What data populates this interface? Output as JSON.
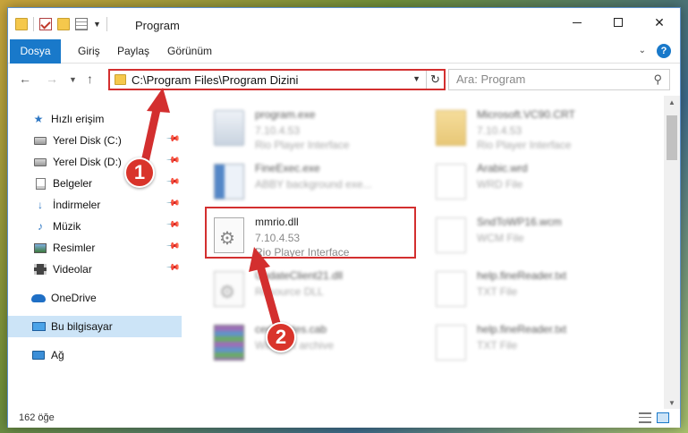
{
  "window": {
    "title": "Program",
    "minimize_glyph": "—",
    "maximize_glyph": "☐",
    "close_glyph": "✕"
  },
  "ribbon": {
    "file_tab": "Dosya",
    "tabs": [
      "Giriş",
      "Paylaş",
      "Görünüm"
    ],
    "help_glyph": "?",
    "expand_glyph": "⌄"
  },
  "address_bar": {
    "path": "C:\\Program Files\\Program Dizini",
    "refresh_glyph": "↻"
  },
  "search": {
    "placeholder": "Ara: Program"
  },
  "nav_pane": {
    "quick_access": "Hızlı erişim",
    "items": [
      {
        "label": "Yerel Disk (C:)",
        "icon": "disk-icon"
      },
      {
        "label": "Yerel Disk (D:)",
        "icon": "disk-icon"
      },
      {
        "label": "Belgeler",
        "icon": "documents-icon"
      },
      {
        "label": "İndirmeler",
        "icon": "downloads-icon"
      },
      {
        "label": "Müzik",
        "icon": "music-icon"
      },
      {
        "label": "Resimler",
        "icon": "pictures-icon"
      },
      {
        "label": "Videolar",
        "icon": "videos-icon"
      }
    ],
    "onedrive": "OneDrive",
    "this_pc": "Bu bilgisayar",
    "network": "Ağ"
  },
  "files": [
    {
      "name": "program.exe",
      "line2": "7.10.4.53",
      "line3": "Rio Player Interface",
      "icon": "exe-icon",
      "blurred": true
    },
    {
      "name": "Microsoft.VC90.CRT",
      "line2": "7.10.4.53",
      "line3": "Rio Player Interface",
      "icon": "folder-icon",
      "blurred": true
    },
    {
      "name": "FineExec.exe",
      "line2": "ABBY background exe...",
      "line3": "",
      "icon": "exe-icon",
      "blurred": true
    },
    {
      "name": "Arabic.wrd",
      "line2": "WRD File",
      "line3": "",
      "icon": "file-icon",
      "blurred": true
    },
    {
      "name": "mmrio.dll",
      "line2": "7.10.4.53",
      "line3": "Rio Player Interface",
      "icon": "dll-gear-icon",
      "blurred": false
    },
    {
      "name": "SndToWP16.wcm",
      "line2": "WCM File",
      "line3": "",
      "icon": "file-icon",
      "blurred": true
    },
    {
      "name": "UpdateClient21.dll",
      "line2": "Resource DLL",
      "line3": "",
      "icon": "dll-gear-icon",
      "blurred": true
    },
    {
      "name": "help.fineReader.txt",
      "line2": "TXT File",
      "line3": "",
      "icon": "file-icon",
      "blurred": true
    },
    {
      "name": "certificates.cab",
      "line2": "WinRAR archive",
      "line3": "",
      "icon": "archive-icon",
      "blurred": true
    },
    {
      "name": "help.fineReader.txt",
      "line2": "TXT File",
      "line3": "",
      "icon": "file-icon",
      "blurred": true
    }
  ],
  "status": {
    "item_count": "162 öğe"
  },
  "annotations": {
    "step1": "1",
    "step2": "2",
    "color": "#d32f2f"
  }
}
